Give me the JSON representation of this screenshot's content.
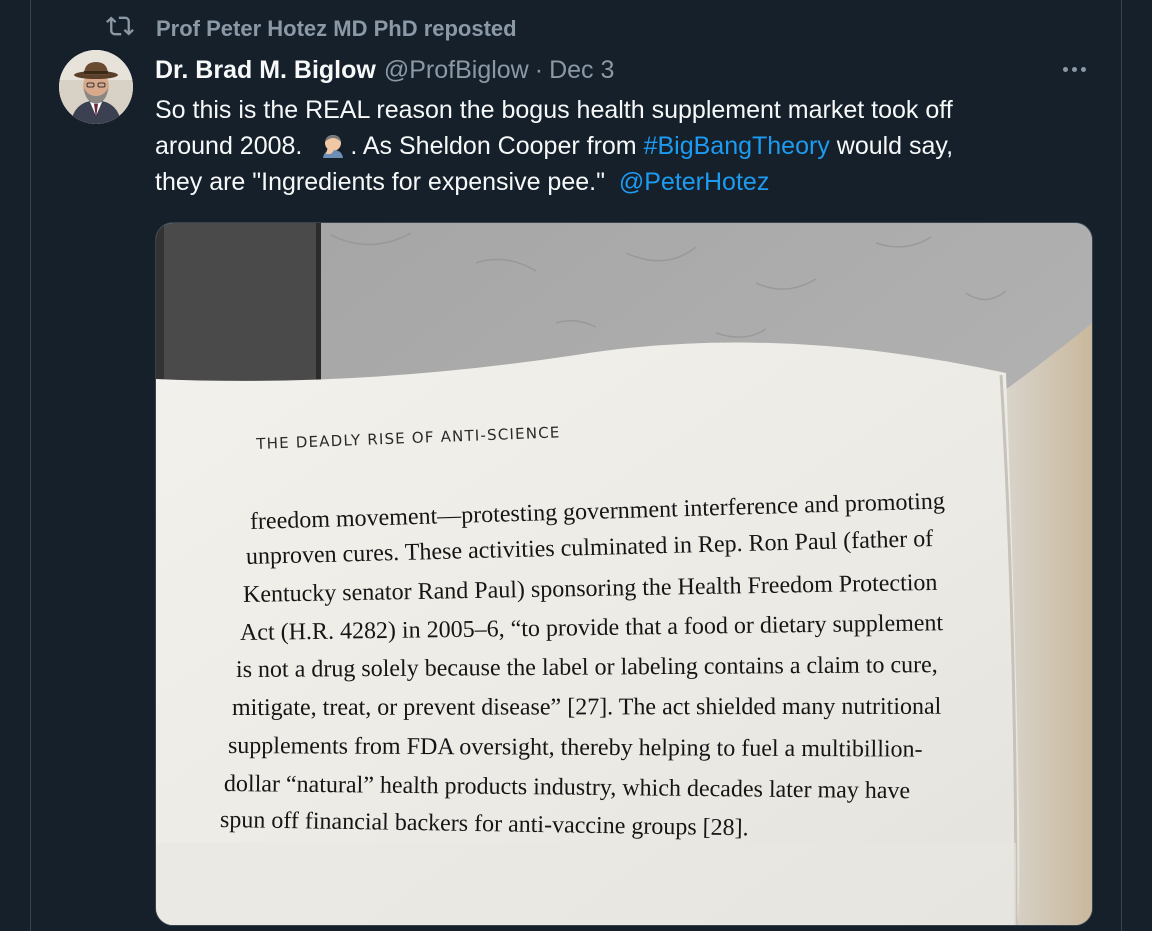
{
  "repost": {
    "icon": "repost-icon",
    "text": "Prof Peter Hotez MD PhD reposted"
  },
  "tweet": {
    "author_name": "Dr. Brad M. Biglow",
    "handle": "@ProfBiglow",
    "separator": "·",
    "date": "Dec 3",
    "more_icon": "more-horizontal-icon",
    "text": {
      "line1": "So this is the REAL reason the bogus health supplement market took off",
      "line2_a": "around 2008.",
      "line2_emoji": "man-facepalming-emoji",
      "line2_b": ". As Sheldon Cooper from ",
      "line2_hashtag": "#BigBangTheory",
      "line2_c": " would say,",
      "line3_a": "they are \"Ingredients for expensive pee.\"",
      "line3_mention": "@PeterHotez"
    }
  },
  "media": {
    "page_header": "THE DEADLY RISE OF ANTI-SCIENCE",
    "lines": [
      "freedom movement—protesting government interference and promoting",
      "unproven cures. These activities culminated in Rep. Ron Paul (father of",
      "Kentucky senator Rand Paul) sponsoring the Health Freedom Protection",
      "Act (H.R. 4282) in 2005–6, “to provide that a food or dietary supplement",
      "is not a drug solely because the label or labeling contains a claim to cure,",
      "mitigate, treat, or prevent disease” [27]. The act shielded many nutritional",
      "supplements from FDA oversight, thereby helping to fuel a multibillion-",
      "dollar “natural” health products industry, which decades later may have",
      "spun off financial backers for anti-vaccine groups [28]."
    ]
  },
  "colors": {
    "background": "#15202b",
    "text_primary": "#f7f9f9",
    "text_secondary": "#8b98a5",
    "link": "#1d9bf0"
  }
}
